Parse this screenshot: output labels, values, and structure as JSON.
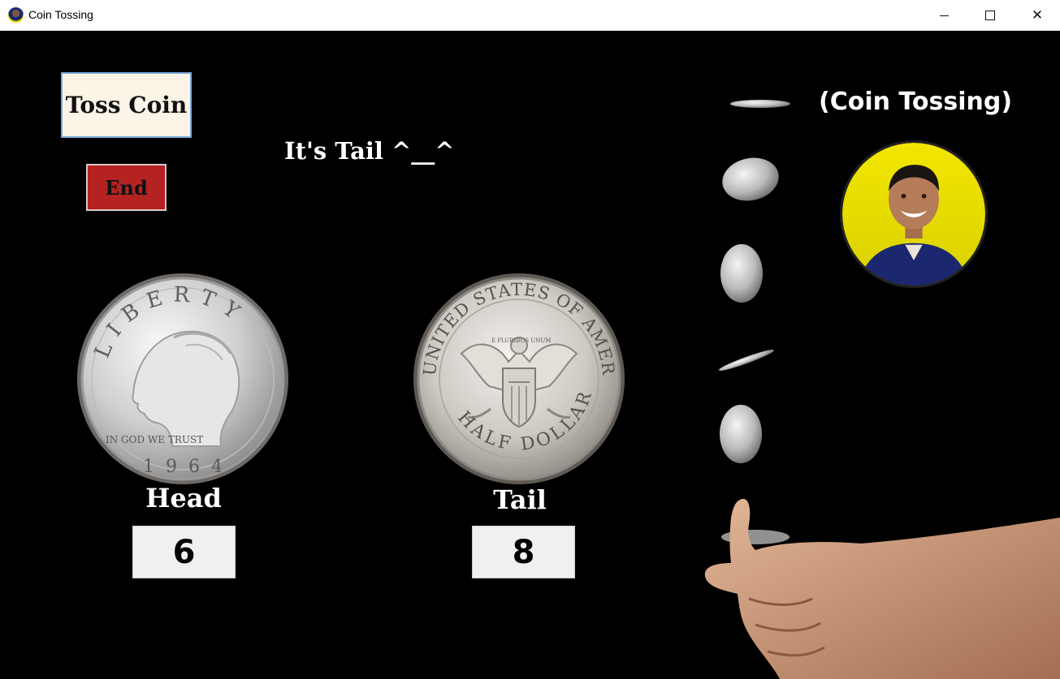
{
  "window": {
    "title": "Coin Tossing",
    "controls": {
      "minimize": "minimize-icon",
      "maximize": "maximize-icon",
      "close": "close-icon"
    },
    "close_glyph": "✕"
  },
  "controls": {
    "toss_label": "Toss Coin",
    "end_label": "End"
  },
  "result": "It's Tail ^__^",
  "heading": "(Coin Tossing)",
  "coins": {
    "head": {
      "label": "Head",
      "count": "6",
      "inscription_top": "LIBERTY",
      "motto": "IN GOD WE TRUST",
      "year": "1964"
    },
    "tail": {
      "label": "Tail",
      "count": "8",
      "inscription_top": "UNITED STATES OF AMERICA",
      "inscription_bottom": "HALF DOLLAR",
      "motto": "E PLURIBUS UNUM"
    }
  },
  "colors": {
    "background": "#000000",
    "toss_button_bg": "#fbf4e7",
    "toss_button_border": "#7aa8d8",
    "end_button_bg": "#b42222",
    "count_box_bg": "#f0f0f0",
    "text_light": "#ffffff",
    "avatar_ring": "#e8d400"
  }
}
